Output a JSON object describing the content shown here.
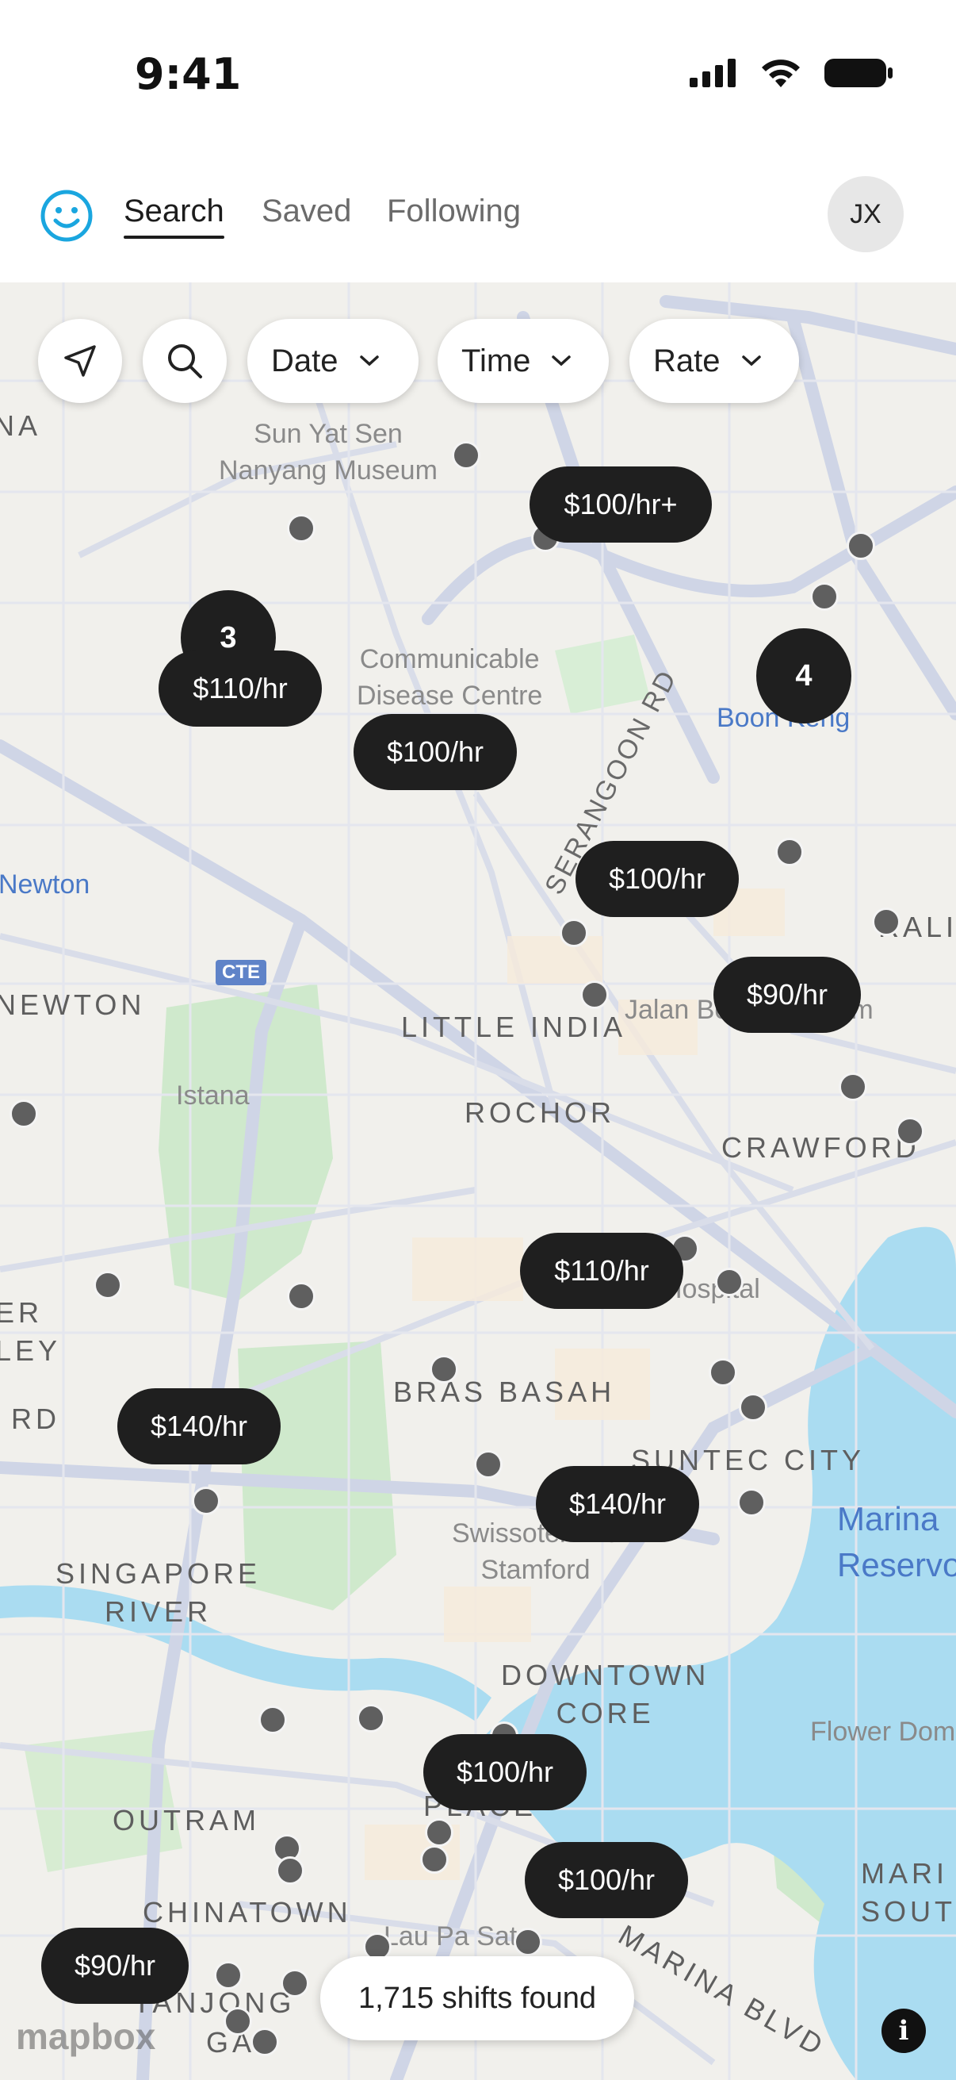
{
  "status_bar": {
    "time": "9:41"
  },
  "header": {
    "tabs": [
      {
        "label": "Search",
        "active": true
      },
      {
        "label": "Saved",
        "active": false
      },
      {
        "label": "Following",
        "active": false
      }
    ],
    "avatar_initials": "JX"
  },
  "filters": {
    "date": "Date",
    "time": "Time",
    "rate": "Rate"
  },
  "map": {
    "labels": {
      "na": "NA",
      "sun_yat_sen": "Sun Yat Sen\nNanyang Museum",
      "cdc": "Communicable\nDisease Centre",
      "boon_keng": "Boon Keng",
      "newton_mrt": "Newton",
      "cte": "CTE",
      "newton": "NEWTON",
      "istana": "Istana",
      "little_india": "LITTLE INDIA",
      "serangoon_rd": "SERANGOON RD",
      "jalan": "Jalan Besar Stadium",
      "ral": "RALI",
      "rochor": "ROCHOR",
      "crawford": "CRAWFORD",
      "hospital": "Hospital",
      "er": "ER",
      "ley": "LEY",
      "rd": "RD",
      "bras_basah": "BRAS BASAH",
      "suntec": "SUNTEC CITY",
      "marina_reservoir": "Marina\nReservoir",
      "swissotel": "Swissotel The\nStamford",
      "singapore_river": "SINGAPORE\nRIVER",
      "downtown": "DOWNTOWN\nCORE",
      "flower_dome": "Flower Dome",
      "outram": "OUTRAM",
      "place": "PLACE",
      "marina_south": "MARI\nSOUT",
      "chinatown": "CHINATOWN",
      "lau_pa_sat": "Lau Pa Sat",
      "tanjong": "TANJONG",
      "marina_blvd": "MARINA BLVD",
      "gar": "GAR"
    },
    "price_pins": [
      "$100/hr+",
      "$110/hr",
      "$100/hr",
      "$100/hr",
      "$90/hr",
      "$110/hr",
      "$140/hr",
      "$140/hr",
      "$100/hr",
      "$100/hr",
      "$90/hr"
    ],
    "clusters": [
      "3",
      "4"
    ]
  },
  "footer": {
    "shifts_found": "1,715 shifts found",
    "attribution": "mapbox"
  },
  "colors": {
    "accent": "#1aa6df",
    "pin": "#1f1f1f",
    "water": "#a9dcf2",
    "park": "#cdeccd"
  }
}
